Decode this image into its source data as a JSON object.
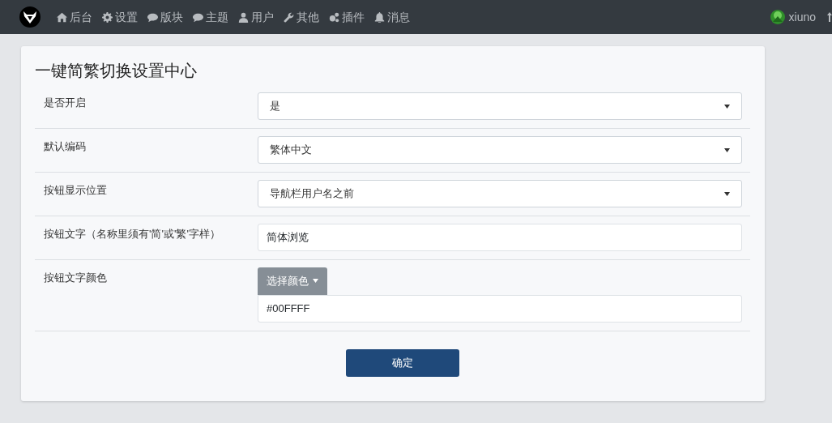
{
  "navbar": {
    "items": [
      {
        "label": "后台"
      },
      {
        "label": "设置"
      },
      {
        "label": "版块"
      },
      {
        "label": "主题"
      },
      {
        "label": "用户"
      },
      {
        "label": "其他"
      },
      {
        "label": "插件"
      },
      {
        "label": "消息"
      }
    ],
    "user": {
      "name": "xiuno"
    }
  },
  "card": {
    "title": "一键简繁切换设置中心",
    "fields": [
      {
        "kind": "select",
        "label": "是否开启",
        "value": "是"
      },
      {
        "kind": "select",
        "label": "默认编码",
        "value": "繁体中文"
      },
      {
        "kind": "select",
        "label": "按钮显示位置",
        "value": "导航栏用户名之前"
      },
      {
        "kind": "text",
        "label": "按钮文字（名称里须有'简'或'繁'字样）",
        "value": "简体浏览"
      },
      {
        "kind": "color",
        "label": "按钮文字颜色",
        "button": "选择颜色",
        "value": "#00FFFF"
      }
    ],
    "submit": "确定"
  }
}
